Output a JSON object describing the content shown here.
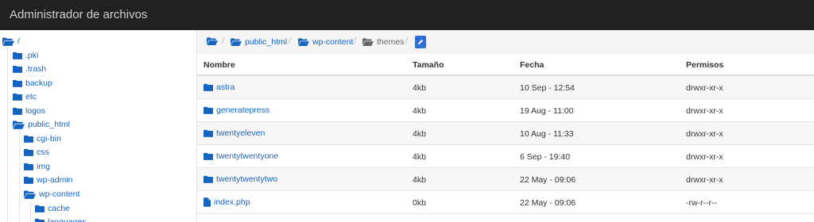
{
  "header": {
    "title": "Administrador de archivos"
  },
  "sidebar": {
    "root": "/",
    "items": [
      {
        "label": ".pki"
      },
      {
        "label": ".trash"
      },
      {
        "label": "backup"
      },
      {
        "label": "etc"
      },
      {
        "label": "logos"
      },
      {
        "label": "public_html"
      },
      {
        "label": "cgi-bin"
      },
      {
        "label": "css"
      },
      {
        "label": "img"
      },
      {
        "label": "wp-admin"
      },
      {
        "label": "wp-content"
      },
      {
        "label": "cache"
      },
      {
        "label": "languages"
      }
    ]
  },
  "breadcrumb": {
    "items": [
      {
        "label": ""
      },
      {
        "label": "public_html"
      },
      {
        "label": "wp-content"
      },
      {
        "label": "themes"
      }
    ],
    "separator": "/"
  },
  "table": {
    "headers": {
      "name": "Nombre",
      "size": "Tamaño",
      "date": "Fecha",
      "perms": "Permisos"
    },
    "rows": [
      {
        "name": "astra",
        "type": "folder",
        "size": "4kb",
        "date": "10 Sep - 12:54",
        "perms": "drwxr-xr-x"
      },
      {
        "name": "generatepress",
        "type": "folder",
        "size": "4kb",
        "date": "19 Aug - 11:00",
        "perms": "drwxr-xr-x"
      },
      {
        "name": "twentyeleven",
        "type": "folder",
        "size": "4kb",
        "date": "10 Aug - 11:33",
        "perms": "drwxr-xr-x"
      },
      {
        "name": "twentytwentyone",
        "type": "folder",
        "size": "4kb",
        "date": "6 Sep - 19:40",
        "perms": "drwxr-xr-x"
      },
      {
        "name": "twentytwentytwo",
        "type": "folder",
        "size": "4kb",
        "date": "22 May - 09:06",
        "perms": "drwxr-xr-x"
      },
      {
        "name": "index.php",
        "type": "file",
        "size": "0kb",
        "date": "22 May - 09:06",
        "perms": "-rw-r--r--"
      }
    ]
  },
  "colors": {
    "header_bg": "#212121",
    "link": "#1565c0",
    "accent_button": "#2f6fd8"
  }
}
